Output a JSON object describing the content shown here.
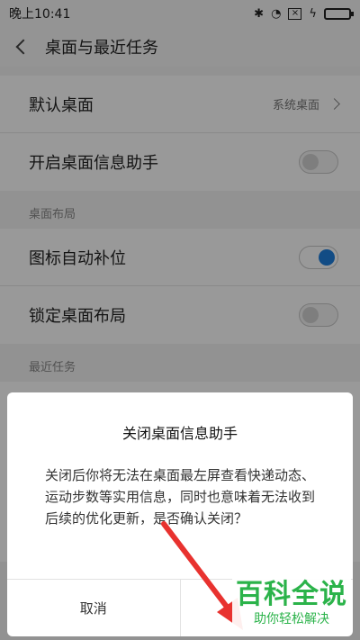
{
  "statusbar": {
    "time": "晚上10:41",
    "bluetooth": "✱",
    "wifi": "◔",
    "sim": "×",
    "charge": "ϟ"
  },
  "header": {
    "title": "桌面与最近任务"
  },
  "settings": {
    "default_desktop": {
      "label": "默认桌面",
      "value": "系统桌面"
    },
    "assistant": {
      "label": "开启桌面信息助手",
      "enabled": false
    },
    "section_layout": "桌面布局",
    "auto_fill": {
      "label": "图标自动补位",
      "enabled": true
    },
    "lock_layout": {
      "label": "锁定桌面布局",
      "enabled": false
    },
    "section_recent": "最近任务"
  },
  "dialog": {
    "title": "关闭桌面信息助手",
    "message": "关闭后你将无法在桌面最左屏查看快递动态、运动步数等实用信息，同时也意味着无法收到后续的优化更新，是否确认关闭？",
    "cancel_label": "取消",
    "confirm_label": ""
  },
  "watermark": {
    "main": "百科全说",
    "sub": "助你轻松解决"
  },
  "colors": {
    "toggle_on": "#1f7fde",
    "arrow": "#e8322f",
    "watermark": "#2bb34a"
  }
}
